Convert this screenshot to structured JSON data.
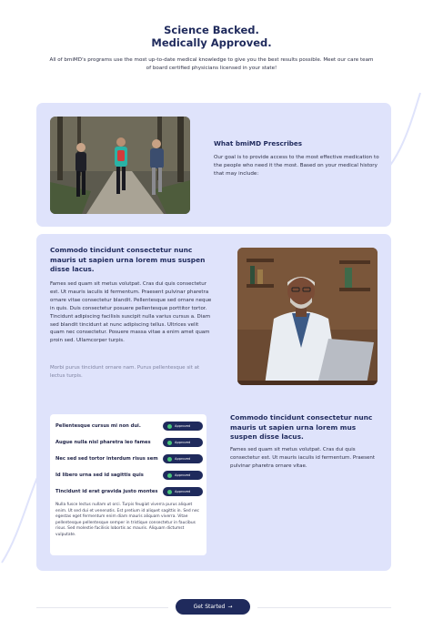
{
  "hero": {
    "title_line1": "Science Backed.",
    "title_line2": "Medically Approved.",
    "text": "All of bmiMD's programs use the most up-to-date medical knowledge to give you the best results possible. Meet our care team of board certified physicians licensed in your state!"
  },
  "prescribes": {
    "title": "What bmiMD Prescribes",
    "text": "Our goal is to provide access to the most effective medication to the people who need it the most. Based on your medical history that may include:"
  },
  "doctor_section": {
    "heading": "Commodo tincidunt consectetur nunc mauris ut sapien urna lorem mus suspen disse lacus.",
    "paragraph": "Fames sed quam sit metus volutpat. Cras dui quis consectetur est. Ut mauris iaculis id fermentum. Praesent pulvinar pharetra ornare vitae consectetur blandit. Pellentesque sed ornare neque in quis. Duis consectetur posuere pellentesque porttitor tortor. Tincidunt adipiscing facilisis suscipit nulla varius cursus a. Diam sed blandit tincidunt at nunc adipiscing tellus. Ultrices velit quam nec consectetur. Posuere massa vitae a enim amet quam proin sed. Ullamcorper turpis.",
    "muted": "Morbi purus tincidunt ornare nam. Purus pellentesque sit at lectus turpis."
  },
  "approvals": {
    "rows": [
      {
        "label": "Pellentesque cursus mi non dui.",
        "badge": "Approved"
      },
      {
        "label": "Augue nulla nisl pharetra leo fames",
        "badge": "Approved"
      },
      {
        "label": "Nec sed sed tortor interdum risus sem",
        "badge": "Approved"
      },
      {
        "label": "Id libero urna sed id sagittis quis",
        "badge": "Approved"
      },
      {
        "label": "Tincidunt id erat gravida justo montes",
        "badge": "Approved"
      }
    ],
    "note": "Nulla fusce lectus nullam ut orci. Turpis feugiat viverra purus aliquet enim. Ut sed dui et venenatis. Est pretium id aliquet sagittis in. Sed nec egestas eget fermentum enim diam mauris aliquam viverra. Vitae pellentesque pellentesque semper in tristique consectetur in faucibus risus. Sed molestie facilisis lobortis ac mauris. Aliquam dictumst vulputate."
  },
  "side_section": {
    "heading": "Commodo tincidunt consectetur nunc mauris ut sapien urna lorem mus suspen disse lacus.",
    "paragraph": "Fames sed quam sit metus volutpat. Cras dui quis consectetur est. Ut mauris iaculis id fermentum. Praesent pulvinar pharetra ornare vitae."
  },
  "cta": {
    "label": "Get Started",
    "arrow": "→"
  },
  "colors": {
    "brand_navy": "#1f2a5c",
    "card_bg": "#dfe3fb",
    "approved_dot": "#48c47a"
  },
  "images": {
    "runners_photo": "photo of three people jogging on a forest trail",
    "doctor_photo": "photo of a doctor with a stethoscope working on a laptop"
  }
}
